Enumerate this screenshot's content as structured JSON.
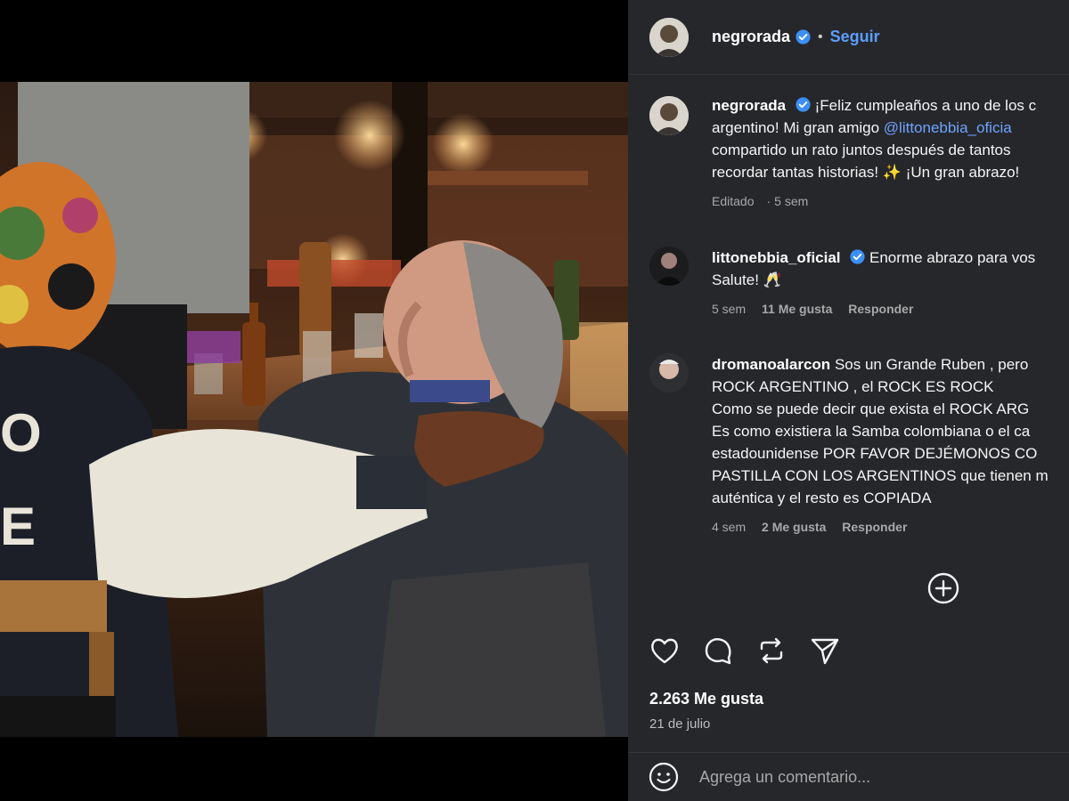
{
  "post": {
    "username": "negrorada",
    "follow_label": "Seguir",
    "separator": "•"
  },
  "caption": {
    "username": "negrorada",
    "line1": "¡Feliz cumpleaños a uno de los c",
    "line2_pre": "argentino! Mi gran amigo ",
    "line2_mention": "@littonebbia_oficia",
    "line3": "compartido un rato juntos después de tantos",
    "line4": "recordar tantas historias! ✨ ¡Un gran abrazo!",
    "meta_edited": "Editado",
    "meta_time": "5 sem"
  },
  "comments": [
    {
      "username": "littonebbia_oficial",
      "lines": [
        "Enorme abrazo para vos",
        "Salute! 🥂"
      ],
      "time": "5 sem",
      "likes": "11 Me gusta",
      "reply": "Responder"
    },
    {
      "username": "dromanoalarcon",
      "lines": [
        "Sos un Grande Ruben , pero",
        "ROCK ARGENTINO , el ROCK ES ROCK",
        "Como se puede decir que exista el ROCK ARG",
        "Es como existiera la Samba colombiana o el ca",
        "estadounidense POR FAVOR DEJÉMONOS CO",
        "PASTILLA CON LOS ARGENTINOS que tienen m",
        "auténtica y el resto es COPIADA"
      ],
      "time": "4 sem",
      "likes": "2 Me gusta",
      "reply": "Responder"
    }
  ],
  "engagement": {
    "likes": "2.263 Me gusta",
    "date": "21 de julio"
  },
  "comment_box": {
    "placeholder": "Agrega un comentario..."
  },
  "icons": {
    "verified": "verified-badge-icon",
    "like": "heart-icon",
    "comment": "comment-bubble-icon",
    "repost": "repost-icon",
    "share": "paper-plane-icon",
    "more": "plus-circle-icon",
    "emoji": "emoji-icon"
  },
  "colors": {
    "panel_bg": "#26272b",
    "accent": "#5c9dff",
    "verified": "#3b8ff6"
  }
}
